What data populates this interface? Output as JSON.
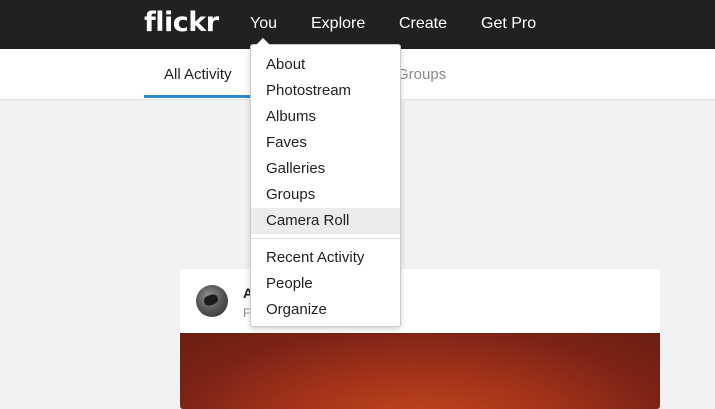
{
  "header": {
    "logo": "flickr",
    "nav": {
      "you": "You",
      "explore": "Explore",
      "create": "Create",
      "get_pro": "Get Pro"
    }
  },
  "subnav": {
    "all_activity": "All Activity",
    "groups_partial": "Groups"
  },
  "dropdown": {
    "items": [
      "About",
      "Photostream",
      "Albums",
      "Faves",
      "Galleries",
      "Groups",
      "Camera Roll",
      "Recent Activity",
      "People",
      "Organize"
    ],
    "highlighted_item": "Camera Roll"
  },
  "feed": {
    "card": {
      "name_partial": "A",
      "sub_partial": "F"
    }
  },
  "colors": {
    "topbar": "#212124",
    "accent": "#2a8bd1",
    "page_background": "#f1f2f3"
  }
}
